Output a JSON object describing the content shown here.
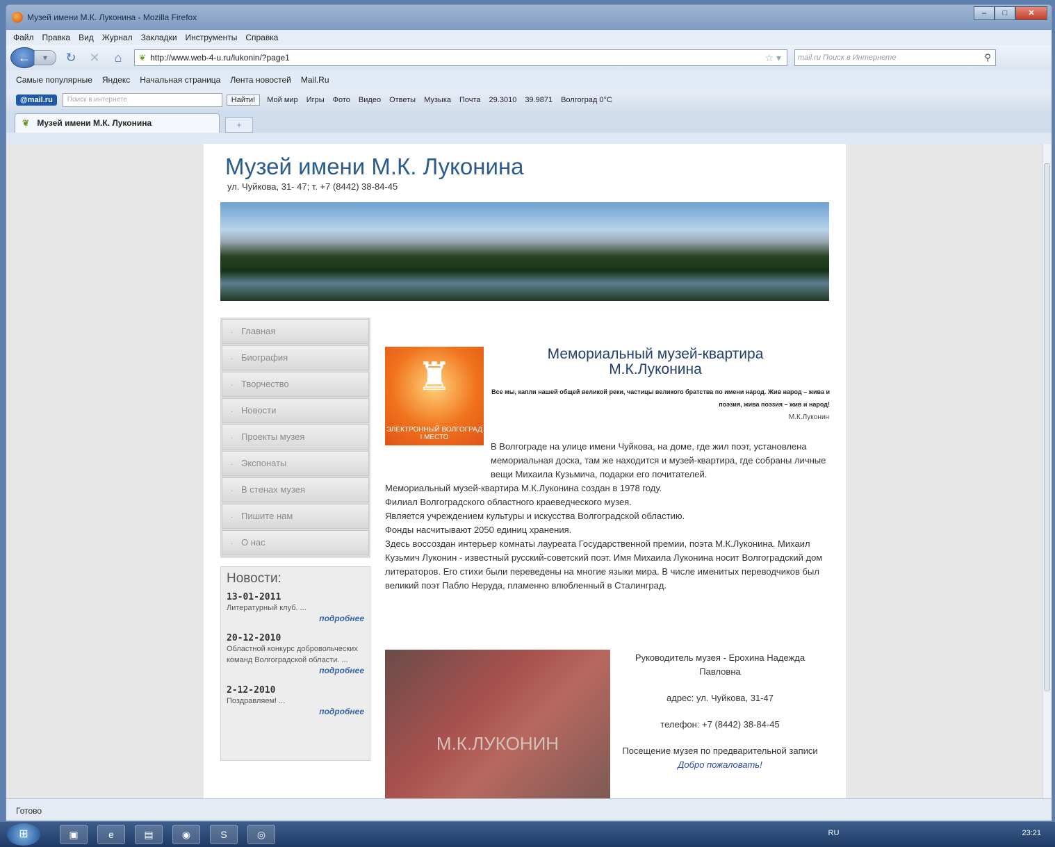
{
  "window": {
    "title": "Музей имени М.К. Луконина - Mozilla Firefox"
  },
  "menu": [
    "Файл",
    "Правка",
    "Вид",
    "Журнал",
    "Закладки",
    "Инструменты",
    "Справка"
  ],
  "url": "http://www.web-4-u.ru/lukonin/?page1",
  "search_placeholder": "mail.ru Поиск в Интернете",
  "bookmarks": [
    "Самые популярные",
    "Яндекс",
    "Начальная страница",
    "Лента новостей",
    "Mail.Ru"
  ],
  "mailbar": {
    "logo": "@mail.ru",
    "search_placeholder": "Поиск в интернете",
    "find": "Найти!",
    "items": [
      "Мой мир",
      "Игры",
      "Фото",
      "Видео",
      "Ответы",
      "Музыка",
      "Почта",
      "29.3010",
      "39.9871",
      "Волгоград 0°C"
    ]
  },
  "tab": {
    "title": "Музей имени М.К. Луконина"
  },
  "site": {
    "title": "Музей имени М.К. Луконина",
    "address_line": "ул. Чуйкова, 31- 47; т. +7 (8442) 38-84-45"
  },
  "nav": [
    "Главная",
    "Биография",
    "Творчество",
    "Новости",
    "Проекты музея",
    "Экспонаты",
    "В стенах музея",
    "Пишите нам",
    "О нас"
  ],
  "news": {
    "heading": "Новости:",
    "items": [
      {
        "date": "13-01-2011",
        "text": "Литературный клуб. ...",
        "more": "подробнее"
      },
      {
        "date": "20-12-2010",
        "text": "Областной конкурс добровольческих команд Волгоградской области. ...",
        "more": "подробнее"
      },
      {
        "date": "2-12-2010",
        "text": "Поздравляем! ...",
        "more": "подробнее"
      }
    ]
  },
  "logo_caption": "ЭЛЕКТРОННЫЙ ВОЛГОГРАД I МЕСТО",
  "article": {
    "heading": "Мемориальный музей-квартира М.К.Луконина",
    "quote": "Все мы, капли нашей общей великой реки, частицы великого братства по имени народ. Жив народ – жива и поэзия, жива поэзия – жив и народ!",
    "quote_author": "М.К.Луконин",
    "p1": "В Волгограде на улице имени Чуйкова, на доме, где жил поэт, установлена мемориальная доска, там же находится и музей-квартира, где собраны личные вещи Михаила Кузьмича, подарки его почитателей.",
    "p2": "Мемориальный музей-квартира М.К.Луконина создан в 1978 году.",
    "p3": "Филиал Волгоградского областного краеведческого музея.",
    "p4": "Является учреждением культуры и искусства Волгоградской областию.",
    "p5": "Фонды насчитывают 2050 единиц хранения.",
    "p6": "Здесь воссоздан интерьер комнаты лауреата Государственной премии, поэта М.К.Луконина. Михаил Кузьмич Луконин - известный русский-советский поэт. Имя Михаила Луконина носит Волгоградский дом литераторов. Его стихи были переведены на многие языки мира. В числе именитых переводчиков был великий поэт Пабло Неруда, пламенно влюбленный в Сталинград."
  },
  "plaque_text": "М.К.ЛУКОНИН",
  "contacts": {
    "head": "Руководитель музея - Ерохина Надежда Павловна",
    "address": "адрес: ул. Чуйкова, 31-47",
    "phone": "телефон: +7 (8442) 38-84-45",
    "visit": "Посещение музея по предварительной записи",
    "welcome": "Добро пожаловать!"
  },
  "status": "Готово",
  "tray": {
    "lang": "RU",
    "time": "23:21"
  }
}
